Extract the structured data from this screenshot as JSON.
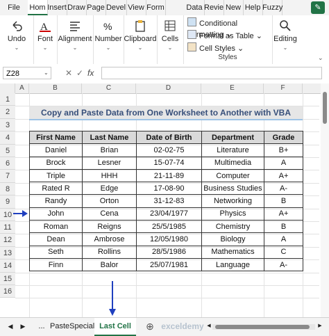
{
  "menu_tabs": [
    "File",
    "Hom",
    "Insert",
    "Draw",
    "Page",
    "Devel",
    "View",
    "Form",
    "Data",
    "Revie",
    "New",
    "Help",
    "Fuzzy"
  ],
  "ribbon": {
    "undo": "Undo",
    "font": "Font",
    "alignment": "Alignment",
    "number": "Number",
    "clipboard": "Clipboard",
    "cells": "Cells",
    "editing": "Editing",
    "cond_format": "Conditional Formatting",
    "format_table": "Format as Table",
    "cell_styles": "Cell Styles",
    "styles_group": "Styles"
  },
  "formula_bar": {
    "name_box": "Z28",
    "fx": "fx",
    "value": ""
  },
  "columns": [
    "A",
    "B",
    "C",
    "D",
    "E",
    "F"
  ],
  "rows": [
    "1",
    "2",
    "3",
    "4",
    "5",
    "6",
    "7",
    "8",
    "9",
    "10",
    "11",
    "12",
    "13",
    "14",
    "15",
    "16"
  ],
  "sheet": {
    "title": "Copy and Paste Data from One Worksheet to Another with VBA",
    "headers": [
      "First Name",
      "Last Name",
      "Date of Birth",
      "Department",
      "Grade"
    ],
    "records": [
      [
        "Daniel",
        "Brian",
        "02-02-75",
        "Literature",
        "B+"
      ],
      [
        "Brock",
        "Lesner",
        "15-07-74",
        "Multimedia",
        "A"
      ],
      [
        "Triple",
        "HHH",
        "21-11-89",
        "Computer",
        "A+"
      ],
      [
        "Rated R",
        "Edge",
        "17-08-90",
        "Business Studies",
        "A-"
      ],
      [
        "Randy",
        "Orton",
        "31-12-83",
        "Networking",
        "B"
      ],
      [
        "John",
        "Cena",
        "23/04/1977",
        "Physics",
        "A+"
      ],
      [
        "Roman",
        "Reigns",
        "25/5/1985",
        "Chemistry",
        "B"
      ],
      [
        "Dean",
        "Ambrose",
        "12/05/1980",
        "Biology",
        "A"
      ],
      [
        "Seth",
        "Rollins",
        "28/5/1986",
        "Mathematics",
        "C"
      ],
      [
        "Finn",
        "Balor",
        "25/07/1981",
        "Language",
        "A-"
      ]
    ]
  },
  "sheet_tabs": {
    "more": "...",
    "tab1": "PasteSpecial",
    "tab2": "Last Cell"
  },
  "watermark": "exceldemy",
  "colors": {
    "accent": "#217346",
    "arrow": "#1f3fbf",
    "title_text": "#374f7a"
  }
}
